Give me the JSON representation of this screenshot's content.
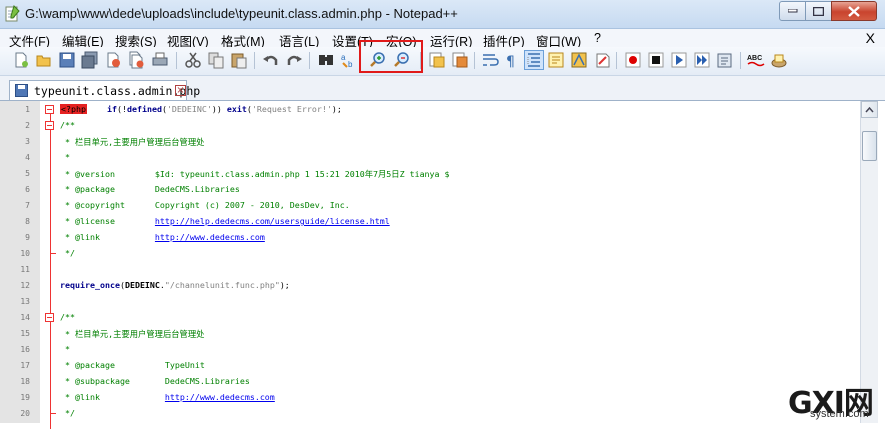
{
  "window": {
    "title": "G:\\wamp\\www\\dede\\uploads\\include\\typeunit.class.admin.php - Notepad++"
  },
  "menu": {
    "items": [
      "文件(F)",
      "编辑(E)",
      "搜索(S)",
      "视图(V)",
      "格式(M)",
      "语言(L)",
      "设置(T)",
      "宏(O)",
      "运行(R)",
      "插件(P)",
      "窗口(W)",
      "?"
    ],
    "close_label": "X"
  },
  "toolbar": {
    "icons": [
      "new-file-icon",
      "open-file-icon",
      "save-icon",
      "save-all-icon",
      "close-icon",
      "close-all-icon",
      "print-icon",
      "cut-icon",
      "copy-icon",
      "paste-icon",
      "undo-icon",
      "redo-icon",
      "find-icon",
      "replace-icon",
      "zoom-in-icon",
      "zoom-out-icon",
      "sync-vertical-icon",
      "sync-horizontal-icon",
      "word-wrap-icon",
      "show-all-chars-icon",
      "indent-guide-icon",
      "user-language-icon",
      "doc-map-icon",
      "function-list-icon",
      "record-macro-icon",
      "stop-macro-icon",
      "play-macro-icon",
      "play-multiple-macro-icon",
      "save-macro-icon",
      "spell-check-icon",
      "plugin-icon"
    ],
    "highlight_color": "#e01a1a"
  },
  "tab": {
    "label": "typeunit.class.admin.php"
  },
  "editor": {
    "lines": [
      {
        "n": "1",
        "parts": [
          [
            "php-tag",
            "<?php"
          ],
          [
            "",
            "    "
          ],
          [
            "kw",
            "if"
          ],
          [
            "",
            "(!"
          ],
          [
            "kw",
            "defined"
          ],
          [
            "",
            "("
          ],
          [
            "str",
            "'DEDEINC'"
          ],
          [
            "",
            "))"
          ],
          [
            "",
            ""
          ],
          [
            "kw",
            " exit"
          ],
          [
            "",
            "("
          ],
          [
            "str",
            "'Request Error!'"
          ],
          [
            "",
            ");"
          ]
        ]
      },
      {
        "n": "2",
        "parts": [
          [
            "comment",
            "/**"
          ]
        ]
      },
      {
        "n": "3",
        "parts": [
          [
            "comment",
            " * 栏目单元,主要用户管理后台管理处"
          ]
        ]
      },
      {
        "n": "4",
        "parts": [
          [
            "comment",
            " *"
          ]
        ]
      },
      {
        "n": "5",
        "parts": [
          [
            "comment",
            " * @version        $Id: typeunit.class.admin.php 1 15:21 2010年7月5日Z tianya $"
          ]
        ]
      },
      {
        "n": "6",
        "parts": [
          [
            "comment",
            " * @package        DedeCMS.Libraries"
          ]
        ]
      },
      {
        "n": "7",
        "parts": [
          [
            "comment",
            " * @copyright      Copyright (c) 2007 - 2010, DesDev, Inc."
          ]
        ]
      },
      {
        "n": "8",
        "parts": [
          [
            "comment",
            " * @license        "
          ],
          [
            "lnk",
            "http://help.dedecms.com/usersguide/license.html"
          ]
        ]
      },
      {
        "n": "9",
        "parts": [
          [
            "comment",
            " * @link           "
          ],
          [
            "lnk",
            "http://www.dedecms.com"
          ]
        ]
      },
      {
        "n": "10",
        "parts": [
          [
            "comment",
            " */"
          ]
        ]
      },
      {
        "n": "11",
        "parts": []
      },
      {
        "n": "12",
        "parts": [
          [
            "kw",
            "require_once"
          ],
          [
            "",
            "("
          ],
          [
            "const",
            "DEDEINC"
          ],
          [
            "",
            "."
          ],
          [
            "str",
            "\"/channelunit.func.php\""
          ],
          [
            "",
            ");"
          ]
        ]
      },
      {
        "n": "13",
        "parts": []
      },
      {
        "n": "14",
        "parts": [
          [
            "comment",
            "/**"
          ]
        ]
      },
      {
        "n": "15",
        "parts": [
          [
            "comment",
            " * 栏目单元,主要用户管理后台管理处"
          ]
        ]
      },
      {
        "n": "16",
        "parts": [
          [
            "comment",
            " *"
          ]
        ]
      },
      {
        "n": "17",
        "parts": [
          [
            "comment",
            " * @package          TypeUnit"
          ]
        ]
      },
      {
        "n": "18",
        "parts": [
          [
            "comment",
            " * @subpackage       DedeCMS.Libraries"
          ]
        ]
      },
      {
        "n": "19",
        "parts": [
          [
            "comment",
            " * @link             "
          ],
          [
            "lnk",
            "http://www.dedecms.com"
          ]
        ]
      },
      {
        "n": "20",
        "parts": [
          [
            "comment",
            " */"
          ]
        ]
      }
    ]
  },
  "watermark": {
    "big": "GXI网",
    "small": "system.com"
  }
}
